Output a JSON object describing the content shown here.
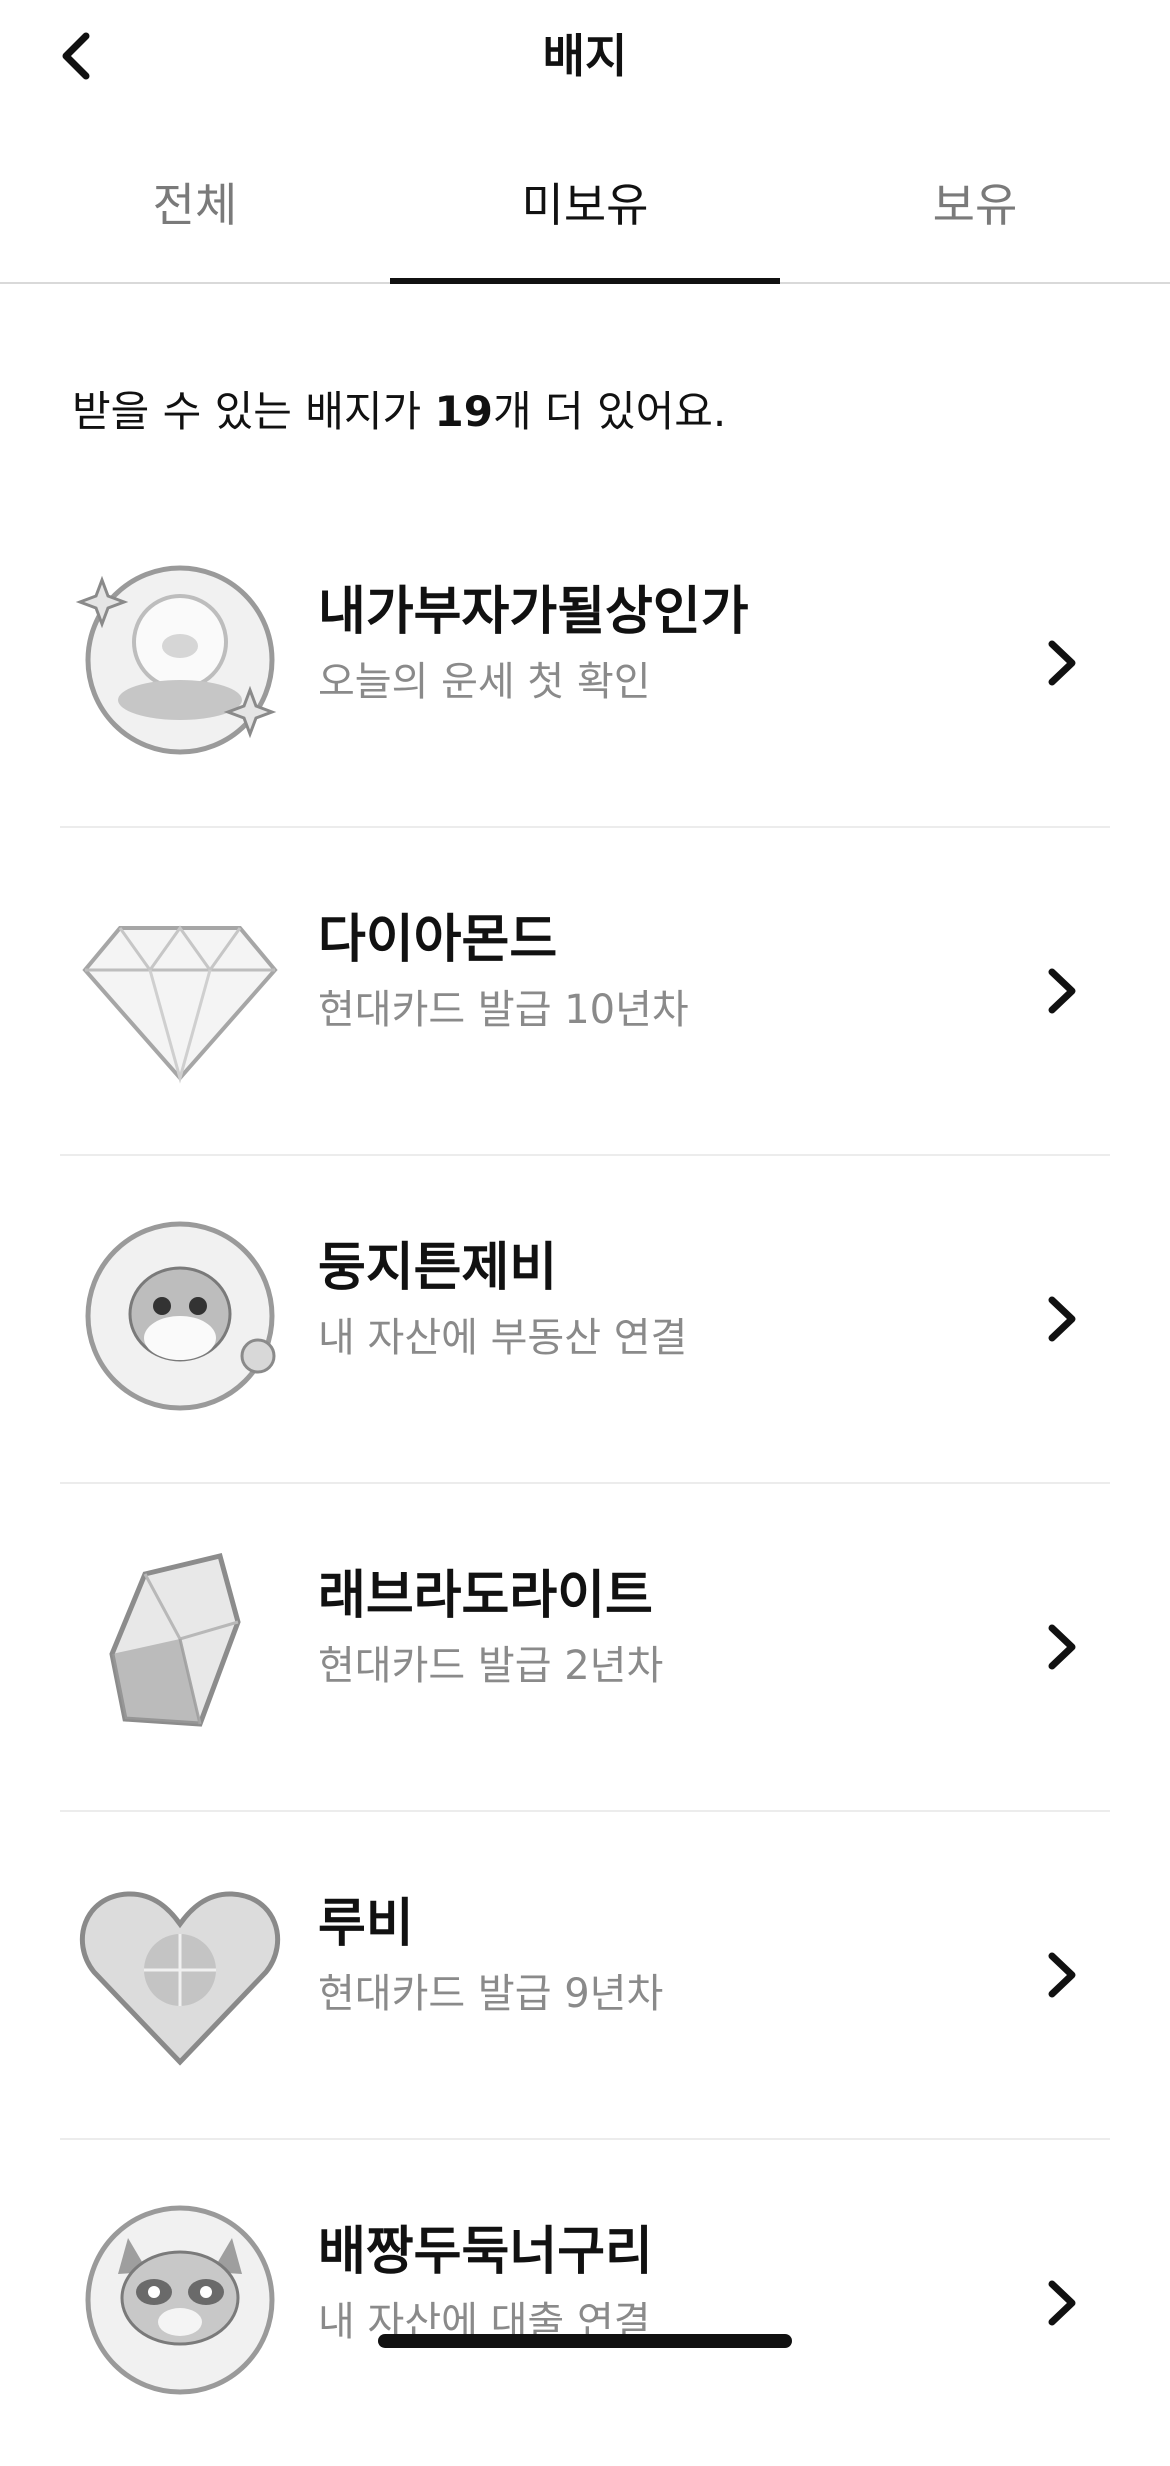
{
  "header": {
    "title": "배지",
    "back_icon": "chevron-left-icon"
  },
  "tabs": [
    {
      "label": "전체",
      "active": false
    },
    {
      "label": "미보유",
      "active": true
    },
    {
      "label": "보유",
      "active": false
    }
  ],
  "summary": {
    "prefix": "받을 수 있는 배지가 ",
    "count": "19",
    "suffix": "개 더 있어요."
  },
  "badges": [
    {
      "name": "내가부자가될상인가",
      "desc": "오늘의 운세 첫 확인",
      "icon": "crystal-ball-icon"
    },
    {
      "name": "다이아몬드",
      "desc": "현대카드 발급 10년차",
      "icon": "diamond-icon"
    },
    {
      "name": "둥지튼제비",
      "desc": "내 자산에 부동산 연결",
      "icon": "swallow-character-icon"
    },
    {
      "name": "래브라도라이트",
      "desc": "현대카드 발급 2년차",
      "icon": "gem-crystal-icon"
    },
    {
      "name": "루비",
      "desc": "현대카드 발급 9년차",
      "icon": "heart-gem-icon"
    },
    {
      "name": "배짱두둑너구리",
      "desc": "내 자산에 대출 연결",
      "icon": "raccoon-character-icon"
    }
  ]
}
